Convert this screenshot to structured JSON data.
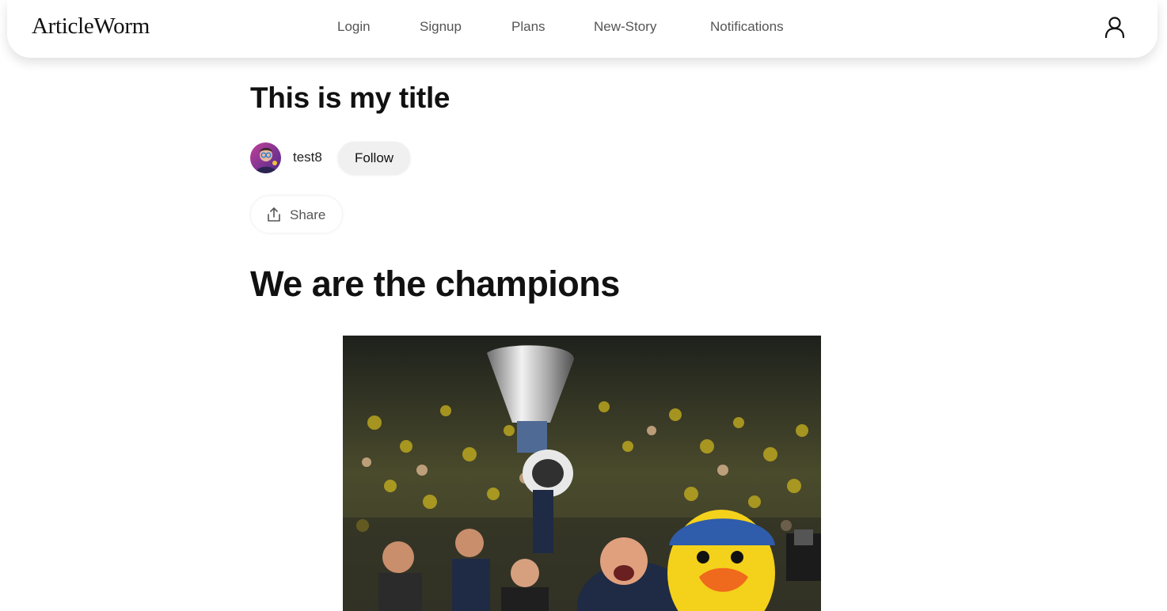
{
  "nav": {
    "brand": "ArticleWorm",
    "links": [
      "Login",
      "Signup",
      "Plans",
      "New-Story",
      "Notifications"
    ]
  },
  "article": {
    "title": "This is my title",
    "author": "test8",
    "follow_label": "Follow",
    "share_label": "Share",
    "heading": "We are the champions"
  },
  "icons": {
    "profile": "user-icon",
    "share": "share-upload-icon"
  },
  "colors": {
    "background": "#ffffff",
    "text": "#111111",
    "nav_link": "#555555",
    "follow_bg": "#f0f0f0"
  }
}
